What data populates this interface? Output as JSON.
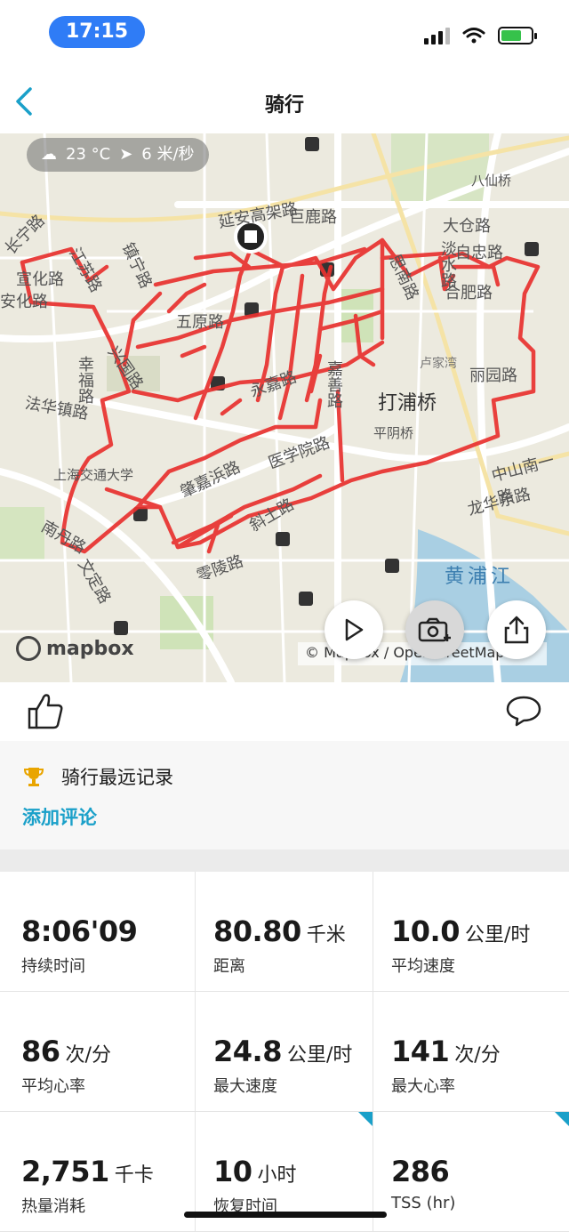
{
  "status_bar": {
    "time": "17:15"
  },
  "nav": {
    "title": "骑行"
  },
  "map": {
    "weather_temp": "23 °C",
    "weather_wind": "6 米/秒",
    "labels": [
      "延安高架路",
      "巨鹿路",
      "江苏路",
      "镇宁路",
      "宣化路",
      "安化路",
      "长宁路",
      "五原路",
      "兴国路",
      "幸福路",
      "法华镇路",
      "永嘉路",
      "嘉善路",
      "思南路",
      "淡水路",
      "自忠路",
      "合肥路",
      "大仓路",
      "卢家湾",
      "打浦桥",
      "丽园路",
      "平阴桥",
      "医学院路",
      "肇嘉浜路",
      "斜土路",
      "上海交通大学",
      "零陵路",
      "南丹路",
      "中山南一路",
      "龙华东路",
      "黄浦江",
      "文定路",
      "八仙桥"
    ],
    "brand": "mapbox",
    "attribution": "© Mapbox / OpenStreetMap",
    "colors": {
      "route": "#e8312f",
      "land": "#eceadf",
      "water": "#a9cfe3",
      "park": "#cfe3b8"
    }
  },
  "buttons": {
    "play": "play-icon",
    "photo": "camera-add-icon",
    "share": "share-icon"
  },
  "record": {
    "title": "骑行最远记录",
    "add_comment": "添加评论"
  },
  "stats": [
    {
      "value": "8:06'09",
      "unit": "",
      "label": "持续时间"
    },
    {
      "value": "80.80",
      "unit": "千米",
      "label": "距离"
    },
    {
      "value": "10.0",
      "unit": "公里/时",
      "label": "平均速度"
    },
    {
      "value": "86",
      "unit": "次/分",
      "label": "平均心率"
    },
    {
      "value": "24.8",
      "unit": "公里/时",
      "label": "最大速度"
    },
    {
      "value": "141",
      "unit": "次/分",
      "label": "最大心率"
    },
    {
      "value": "2,751",
      "unit": "千卡",
      "label": "热量消耗"
    },
    {
      "value": "10",
      "unit": "小时",
      "label": "恢复时间"
    },
    {
      "value": "286",
      "unit": "",
      "label": "TSS (hr)"
    }
  ],
  "accent": "#1aa0c9"
}
